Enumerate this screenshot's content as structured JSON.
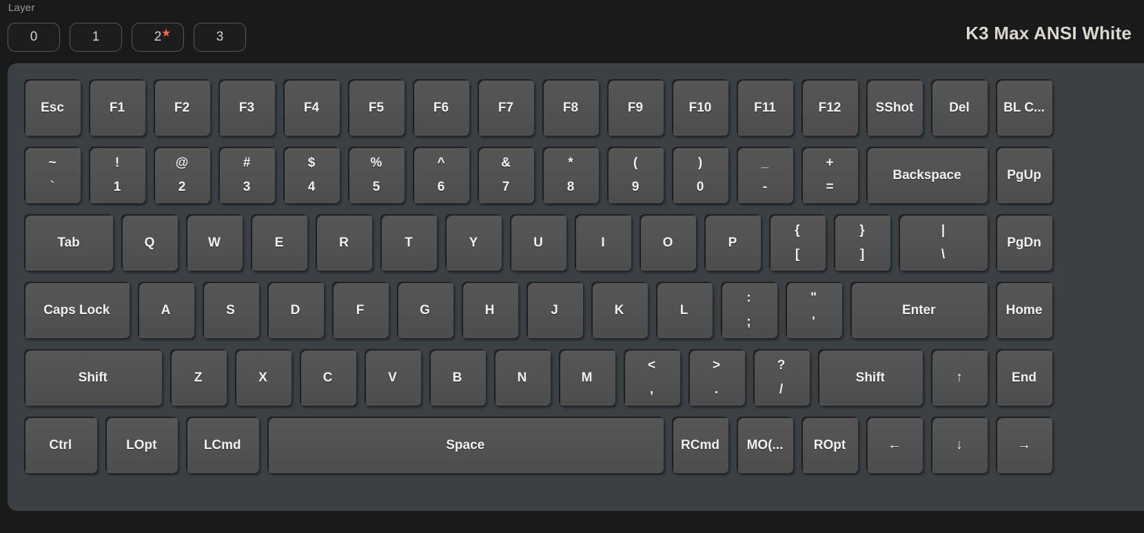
{
  "header": {
    "layer_label": "Layer",
    "layers": [
      {
        "label": "0",
        "selected": false,
        "starred": false
      },
      {
        "label": "1",
        "selected": false,
        "starred": false
      },
      {
        "label": "2",
        "selected": true,
        "starred": true
      },
      {
        "label": "3",
        "selected": false,
        "starred": false
      }
    ],
    "star_glyph": "★",
    "keyboard_title": "K3 Max ANSI White",
    "accent_color": "#f4663a",
    "case_color": "#3a4044",
    "key_color": "#525252",
    "background_color": "#1a1a1a"
  },
  "keyboard": {
    "name": "K3 Max ANSI White",
    "rows": [
      {
        "keys": [
          {
            "main": "Esc",
            "w": 1
          },
          {
            "main": "F1",
            "w": 1
          },
          {
            "main": "F2",
            "w": 1
          },
          {
            "main": "F3",
            "w": 1
          },
          {
            "main": "F4",
            "w": 1
          },
          {
            "main": "F5",
            "w": 1
          },
          {
            "main": "F6",
            "w": 1
          },
          {
            "main": "F7",
            "w": 1
          },
          {
            "main": "F8",
            "w": 1
          },
          {
            "main": "F9",
            "w": 1
          },
          {
            "main": "F10",
            "w": 1
          },
          {
            "main": "F11",
            "w": 1
          },
          {
            "main": "F12",
            "w": 1
          },
          {
            "main": "SShot",
            "w": 1
          },
          {
            "main": "Del",
            "w": 1
          },
          {
            "main": "BL C...",
            "w": 1
          }
        ]
      },
      {
        "keys": [
          {
            "top": "~",
            "bot": "`",
            "w": 1
          },
          {
            "top": "!",
            "bot": "1",
            "w": 1
          },
          {
            "top": "@",
            "bot": "2",
            "w": 1
          },
          {
            "top": "#",
            "bot": "3",
            "w": 1
          },
          {
            "top": "$",
            "bot": "4",
            "w": 1
          },
          {
            "top": "%",
            "bot": "5",
            "w": 1
          },
          {
            "top": "^",
            "bot": "6",
            "w": 1
          },
          {
            "top": "&",
            "bot": "7",
            "w": 1
          },
          {
            "top": "*",
            "bot": "8",
            "w": 1
          },
          {
            "top": "(",
            "bot": "9",
            "w": 1
          },
          {
            "top": ")",
            "bot": "0",
            "w": 1
          },
          {
            "top": "_",
            "bot": "-",
            "w": 1
          },
          {
            "top": "+",
            "bot": "=",
            "w": 1
          },
          {
            "main": "Backspace",
            "w": 2
          },
          {
            "main": "PgUp",
            "w": 1
          }
        ]
      },
      {
        "keys": [
          {
            "main": "Tab",
            "w": 1.5
          },
          {
            "main": "Q",
            "w": 1
          },
          {
            "main": "W",
            "w": 1
          },
          {
            "main": "E",
            "w": 1
          },
          {
            "main": "R",
            "w": 1
          },
          {
            "main": "T",
            "w": 1
          },
          {
            "main": "Y",
            "w": 1
          },
          {
            "main": "U",
            "w": 1
          },
          {
            "main": "I",
            "w": 1
          },
          {
            "main": "O",
            "w": 1
          },
          {
            "main": "P",
            "w": 1
          },
          {
            "top": "{",
            "bot": "[",
            "w": 1
          },
          {
            "top": "}",
            "bot": "]",
            "w": 1
          },
          {
            "top": "|",
            "bot": "\\",
            "w": 1.5
          },
          {
            "main": "PgDn",
            "w": 1
          }
        ]
      },
      {
        "keys": [
          {
            "main": "Caps Lock",
            "w": 1.75
          },
          {
            "main": "A",
            "w": 1
          },
          {
            "main": "S",
            "w": 1
          },
          {
            "main": "D",
            "w": 1
          },
          {
            "main": "F",
            "w": 1
          },
          {
            "main": "G",
            "w": 1
          },
          {
            "main": "H",
            "w": 1
          },
          {
            "main": "J",
            "w": 1
          },
          {
            "main": "K",
            "w": 1
          },
          {
            "main": "L",
            "w": 1
          },
          {
            "top": ":",
            "bot": ";",
            "w": 1
          },
          {
            "top": "\"",
            "bot": "'",
            "w": 1
          },
          {
            "main": "Enter",
            "w": 2.25
          },
          {
            "main": "Home",
            "w": 1
          }
        ]
      },
      {
        "keys": [
          {
            "main": "Shift",
            "w": 2.25
          },
          {
            "main": "Z",
            "w": 1
          },
          {
            "main": "X",
            "w": 1
          },
          {
            "main": "C",
            "w": 1
          },
          {
            "main": "V",
            "w": 1
          },
          {
            "main": "B",
            "w": 1
          },
          {
            "main": "N",
            "w": 1
          },
          {
            "main": "M",
            "w": 1
          },
          {
            "top": "<",
            "bot": ",",
            "w": 1
          },
          {
            "top": ">",
            "bot": ".",
            "w": 1
          },
          {
            "top": "?",
            "bot": "/",
            "w": 1
          },
          {
            "main": "Shift",
            "w": 1.75
          },
          {
            "main": "↑",
            "w": 1,
            "arrow": true
          },
          {
            "main": "End",
            "w": 1
          }
        ]
      },
      {
        "keys": [
          {
            "main": "Ctrl",
            "w": 1.25
          },
          {
            "main": "LOpt",
            "w": 1.25
          },
          {
            "main": "LCmd",
            "w": 1.25
          },
          {
            "main": "Space",
            "w": 6.25
          },
          {
            "main": "RCmd",
            "w": 1
          },
          {
            "main": "MO(...",
            "w": 1
          },
          {
            "main": "ROpt",
            "w": 1
          },
          {
            "main": "←",
            "w": 1,
            "arrow": true
          },
          {
            "main": "↓",
            "w": 1,
            "arrow": true
          },
          {
            "main": "→",
            "w": 1,
            "arrow": true
          }
        ]
      }
    ]
  }
}
